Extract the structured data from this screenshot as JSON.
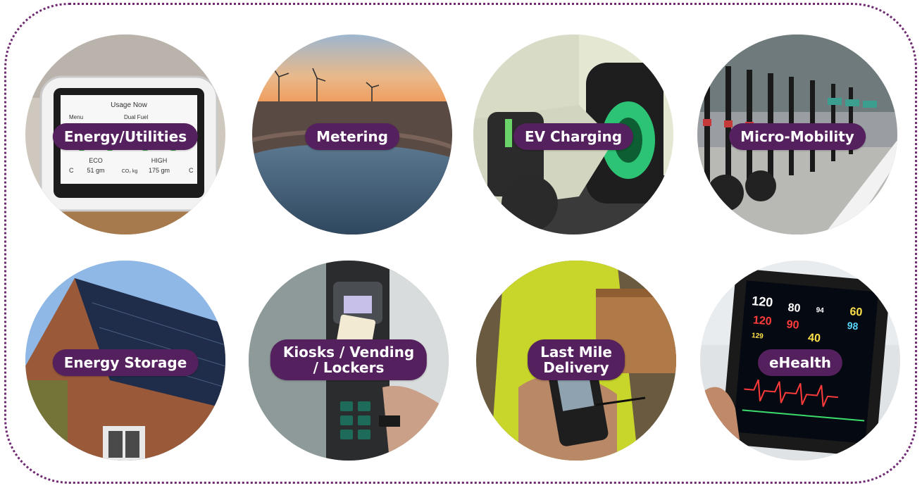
{
  "tiles": [
    {
      "label": "Energy/Utilities",
      "device": {
        "title": "Usage Now",
        "menu": "Menu",
        "fuel": "Dual Fuel",
        "left_mode": "ECO",
        "left_value": "51 gm",
        "right_mode": "HIGH",
        "right_value": "175 gm",
        "unit": "CO₂ kg",
        "cold": "C",
        "warm": "C"
      }
    },
    {
      "label": "Metering"
    },
    {
      "label": "EV Charging"
    },
    {
      "label": "Micro-Mobility"
    },
    {
      "label": "Energy Storage"
    },
    {
      "label_line1": "Kiosks / Vending",
      "label_line2": "/ Lockers"
    },
    {
      "label_line1": "Last Mile",
      "label_line2": "Delivery"
    },
    {
      "label": "eHealth",
      "monitor": {
        "hr": "120",
        "spo2": "80",
        "rr": "94",
        "bp": "60",
        "temp": "98",
        "v1": "120",
        "v2": "90",
        "v3": "129",
        "v4": "40"
      }
    }
  ],
  "colors": {
    "accent": "#55205e",
    "frame": "#6f2a72"
  }
}
